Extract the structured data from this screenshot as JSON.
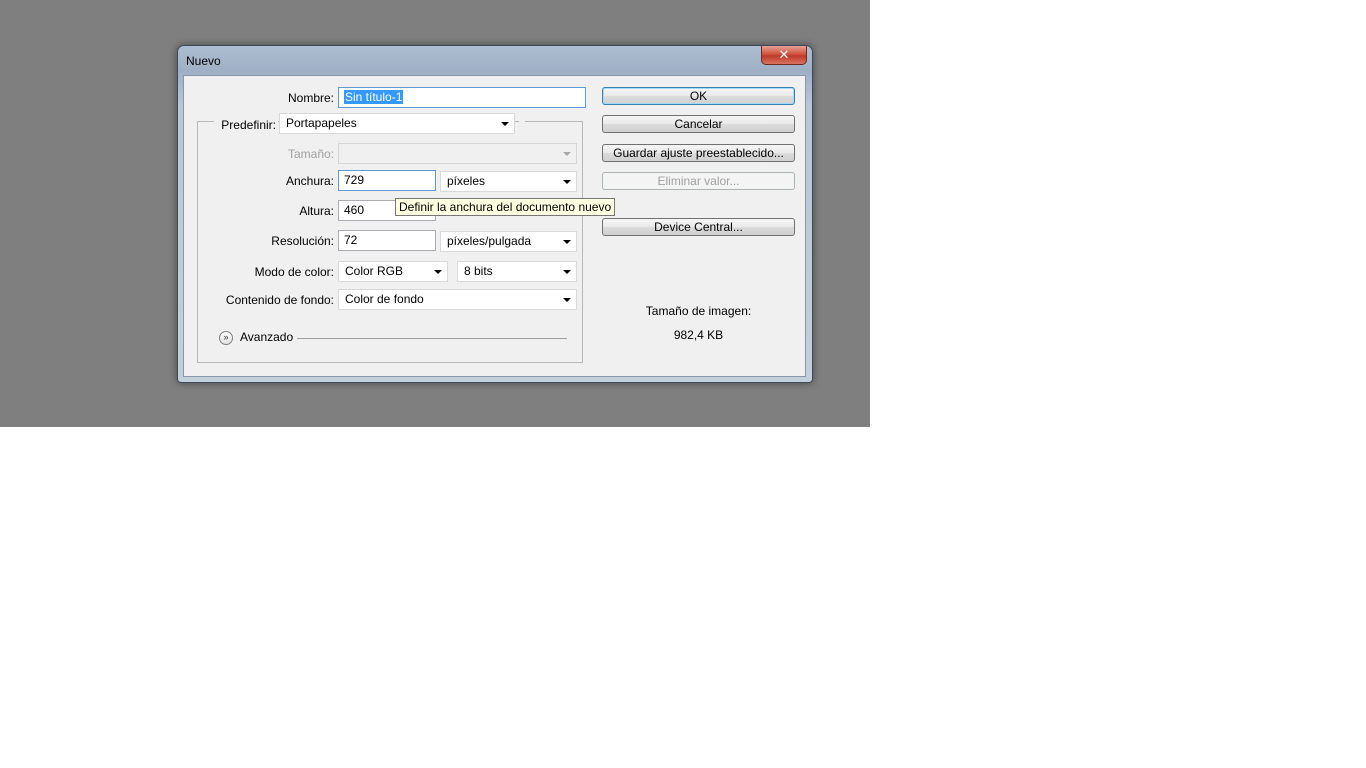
{
  "dialog": {
    "title": "Nuevo",
    "close_glyph": "✕",
    "close_icon": "close-icon"
  },
  "form": {
    "name_label": "Nombre:",
    "name_value": "Sin título-1",
    "preset_label": "Predefinir:",
    "preset_value": "Portapapeles",
    "size_label": "Tamaño:",
    "size_value": "",
    "width_label": "Anchura:",
    "width_value": "729",
    "width_unit": "píxeles",
    "height_label": "Altura:",
    "height_value": "460",
    "resolution_label": "Resolución:",
    "resolution_value": "72",
    "resolution_unit": "píxeles/pulgada",
    "color_mode_label": "Modo de color:",
    "color_mode_value": "Color RGB",
    "bit_depth_value": "8 bits",
    "background_label": "Contenido de fondo:",
    "background_value": "Color de fondo",
    "advanced_label": "Avanzado"
  },
  "tooltip": {
    "text": "Definir la anchura del documento nuevo"
  },
  "buttons": {
    "ok": "OK",
    "cancel": "Cancelar",
    "save_preset": "Guardar ajuste preestablecido...",
    "delete_preset": "Eliminar valor...",
    "device_central": "Device Central..."
  },
  "image_size": {
    "label": "Tamaño de imagen:",
    "value": "982,4 KB"
  }
}
